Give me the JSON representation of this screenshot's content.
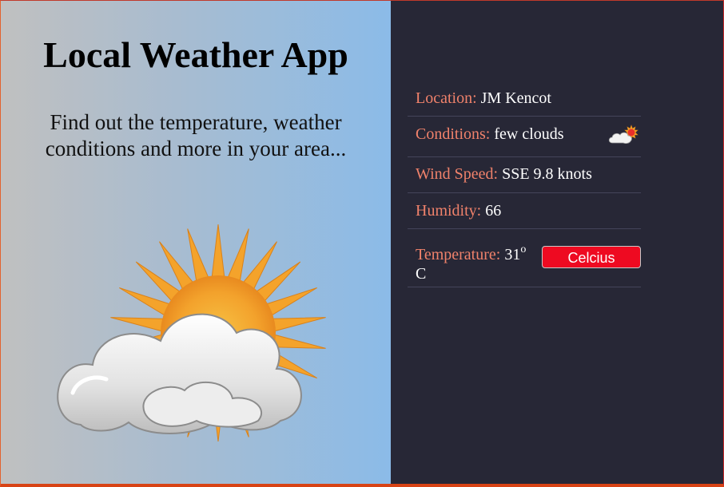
{
  "header": {
    "title": "Local Weather App",
    "subtitle": "Find out the temperature, weather conditions and more in your area..."
  },
  "hero_icon": "sun-behind-cloud-icon",
  "weather": {
    "location": {
      "label": "Location:",
      "value": "JM Kencot"
    },
    "conditions": {
      "label": "Conditions:",
      "value": "few clouds",
      "icon": "few-clouds-icon"
    },
    "wind": {
      "label": "Wind Speed:",
      "value": "SSE 9.8 knots"
    },
    "humidity": {
      "label": "Humidity:",
      "value": "66"
    },
    "temperature": {
      "label": "Temperature:",
      "value": "31",
      "degree": "o",
      "unit": "C"
    }
  },
  "unit_button": {
    "label": "Celcius"
  },
  "colors": {
    "panel": "#272736",
    "label": "#f0826b",
    "button": "#ee0a21",
    "gradient_start": "#c0c0c0",
    "gradient_end": "#8bbbe8"
  }
}
